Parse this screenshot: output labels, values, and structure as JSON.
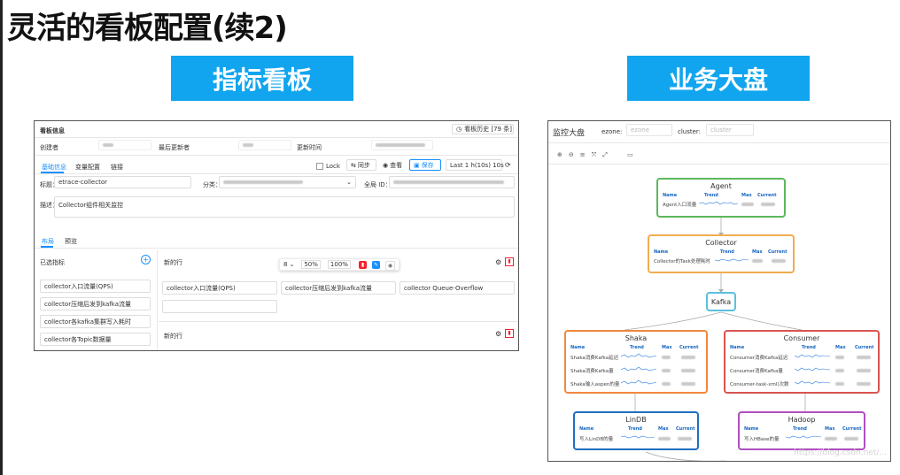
{
  "slide": {
    "title": "灵活的看板配置(续2)",
    "banner_left": "指标看板",
    "banner_right": "业务大盘"
  },
  "dashboard": {
    "header_title": "看板信息",
    "history_button": "看板历史 [79 条]",
    "creator_label": "创建者",
    "updater_label": "最后更新者",
    "update_time_label": "更新时间",
    "tabs": [
      "基础信息",
      "变量配置",
      "链接"
    ],
    "lock_label": "Lock",
    "sync_label": "同步",
    "view_label": "查看",
    "save_label": "保存",
    "time_range": "Last 1 h(10s) 10s",
    "title_label": "标题：",
    "title_value": "etrace-collector",
    "category_label": "分类：",
    "global_id_label": "全局 ID：",
    "desc_label": "描述：",
    "desc_value": "Collector组件相关监控",
    "layout_tabs": [
      "布局",
      "预览"
    ],
    "selected_metrics_label": "已选指标",
    "selected_metrics": [
      "collector入口流量(QPS)",
      "collector压缩后发到kafka流量",
      "collector各kafka集群写入耗时",
      "collector各Topic数据量"
    ],
    "new_row_label": "新的行",
    "zoom_options": [
      "8",
      "50%",
      "100%"
    ],
    "row_metrics": [
      "collector入口流量(QPS)",
      "collector压缩后发到kafka流量",
      "collector Queue-Overflow"
    ],
    "new_row_label_2": "新的行"
  },
  "bizboard": {
    "title": "监控大盘",
    "ezone_label": "ezone:",
    "ezone_placeholder": "ezone",
    "cluster_label": "cluster:",
    "cluster_placeholder": "cluster",
    "col_headers": [
      "Name",
      "Trend",
      "Max",
      "Current"
    ],
    "nodes": {
      "agent": {
        "name": "Agent",
        "rows": [
          "Agent入口流量"
        ],
        "color": "#5cb85c"
      },
      "collector": {
        "name": "Collector",
        "rows": [
          "Collector的Task处理耗时"
        ],
        "color": "#f0ad4e"
      },
      "kafka": {
        "name": "Kafka",
        "color": "#5bc0de"
      },
      "shaka": {
        "name": "Shaka",
        "rows": [
          "Shaka消费Kafka延迟",
          "Shaka消费Kafka量",
          "Shaka输入aspen的量"
        ],
        "color": "#f0883e"
      },
      "consumer": {
        "name": "Consumer",
        "rows": [
          "Consumer消费Kafka延迟",
          "Consumer消费Kafka量",
          "Consumer-task-xml(次数"
        ],
        "color": "#d9534f"
      },
      "lindb": {
        "name": "LinDB",
        "rows": [
          "写入LinDB的量"
        ],
        "color": "#1f6fbf"
      },
      "hadoop": {
        "name": "Hadoop",
        "rows": [
          "写入HBase的量"
        ],
        "color": "#b04fc0"
      }
    }
  }
}
